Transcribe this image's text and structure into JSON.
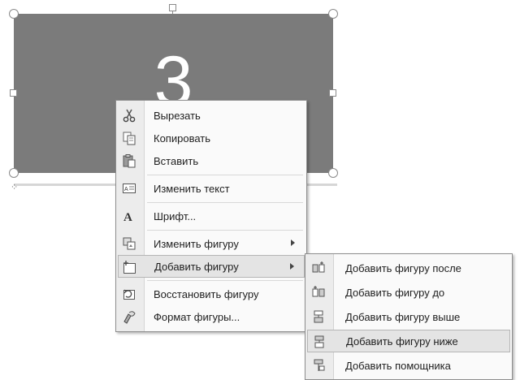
{
  "slide": {
    "shape_number": "3",
    "fill_color": "#7b7b7b"
  },
  "context_menu": {
    "items": [
      {
        "label": "Вырезать",
        "icon": "scissors-icon"
      },
      {
        "label": "Копировать",
        "icon": "copy-icon"
      },
      {
        "label": "Вставить",
        "icon": "paste-icon"
      },
      {
        "label": "Изменить текст",
        "icon": "edit-text-icon"
      },
      {
        "label": "Шрифт...",
        "icon": "font-icon"
      },
      {
        "label": "Изменить фигуру",
        "icon": "change-shape-icon",
        "has_submenu": true
      },
      {
        "label": "Добавить фигуру",
        "icon": "add-shape-icon",
        "has_submenu": true,
        "active": true
      },
      {
        "label": "Восстановить фигуру",
        "icon": "reset-shape-icon"
      },
      {
        "label": "Формат фигуры...",
        "icon": "format-shape-icon"
      }
    ]
  },
  "submenu": {
    "items": [
      {
        "label": "Добавить фигуру после",
        "icon": "add-after-icon"
      },
      {
        "label": "Добавить фигуру до",
        "icon": "add-before-icon"
      },
      {
        "label": "Добавить фигуру выше",
        "icon": "add-above-icon"
      },
      {
        "label": "Добавить фигуру ниже",
        "icon": "add-below-icon",
        "highlighted": true
      },
      {
        "label": "Добавить помощника",
        "icon": "add-assistant-icon"
      }
    ]
  },
  "colors": {
    "highlight": "#e4e4e4",
    "menu_background": "#fafafa",
    "icon_gutter": "#ececec"
  }
}
